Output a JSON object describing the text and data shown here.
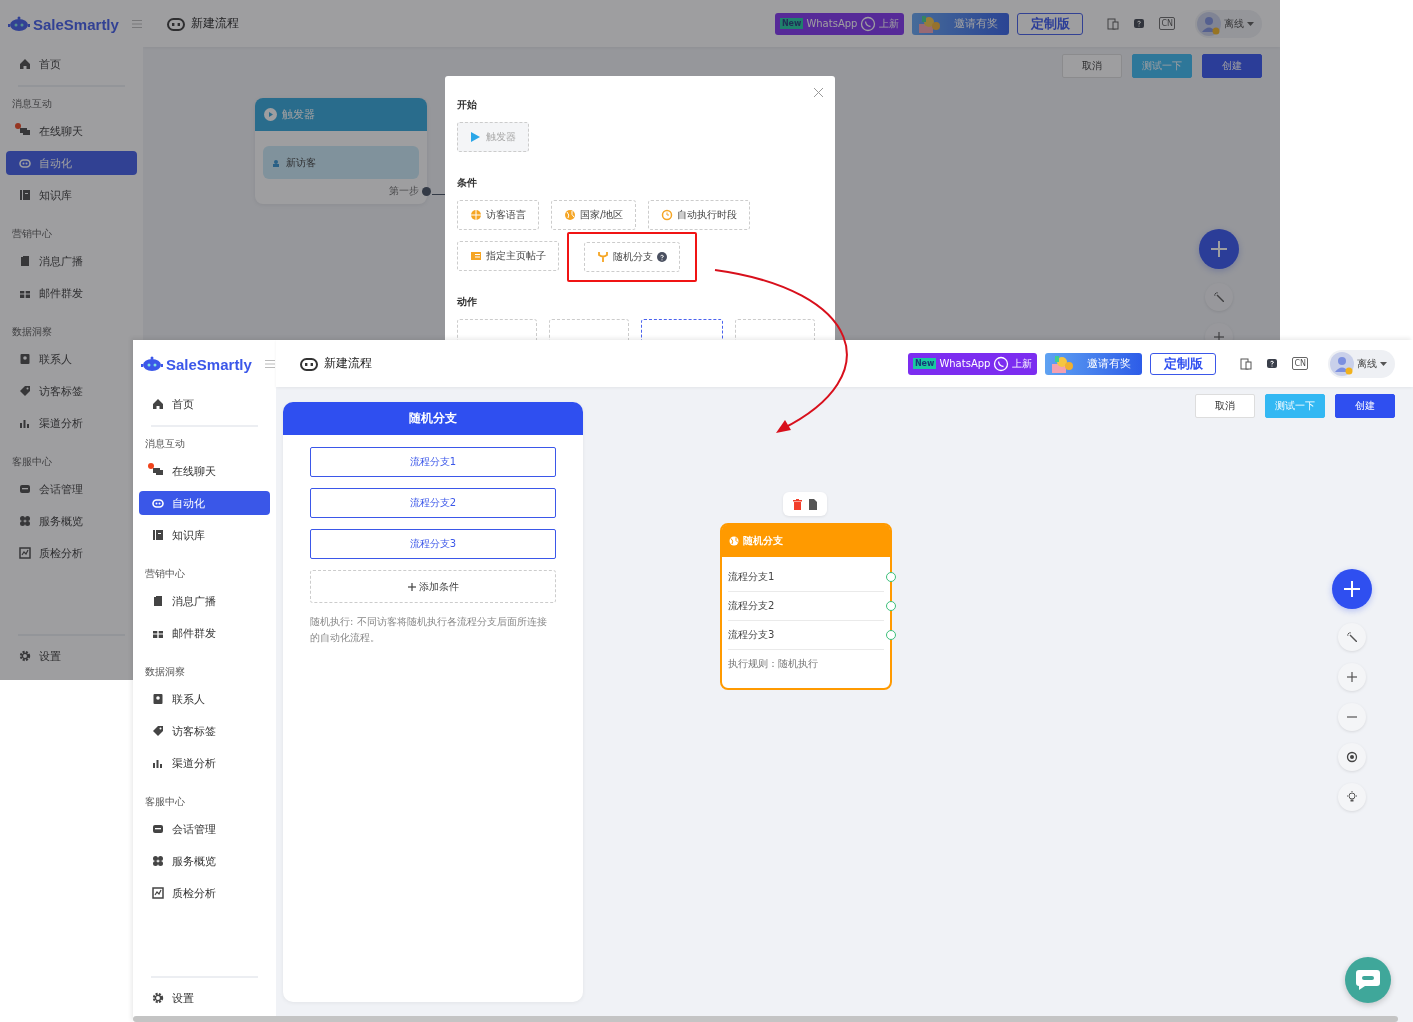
{
  "screens": [
    {
      "kind": "dialog-open",
      "dimmed": true,
      "sidebar": {
        "brand": "SaleSmartly",
        "sections": [
          {
            "items": [
              {
                "label": "首页",
                "selected": false,
                "badge": false
              }
            ]
          },
          {
            "title": "消息互动",
            "items": [
              {
                "label": "在线聊天",
                "selected": false,
                "badge": true
              },
              {
                "label": "自动化",
                "selected": true,
                "badge": false
              },
              {
                "label": "知识库",
                "selected": false,
                "badge": false
              }
            ]
          },
          {
            "title": "营销中心",
            "items": [
              {
                "label": "消息广播",
                "selected": false,
                "badge": false
              },
              {
                "label": "邮件群发",
                "selected": false,
                "badge": false
              }
            ]
          },
          {
            "title": "数据洞察",
            "items": [
              {
                "label": "联系人",
                "selected": false,
                "badge": false
              },
              {
                "label": "访客标签",
                "selected": false,
                "badge": false
              },
              {
                "label": "渠道分析",
                "selected": false,
                "badge": false
              }
            ]
          },
          {
            "title": "客服中心",
            "items": [
              {
                "label": "会话管理",
                "selected": false,
                "badge": false
              },
              {
                "label": "服务概览",
                "selected": false,
                "badge": false
              },
              {
                "label": "质检分析",
                "selected": false,
                "badge": false
              }
            ]
          }
        ],
        "footer_item": "设置"
      },
      "header": {
        "title": "新建流程",
        "whatsapp_badge": {
          "tag": "New",
          "name": "WhatsApp",
          "suffix": "上新"
        },
        "invite_banner": "邀请有奖",
        "plan_button": "定制版",
        "language_badge": "CN",
        "status": "离线"
      },
      "toolbar_buttons": [
        {
          "label": "取消",
          "kind": "default"
        },
        {
          "label": "测试一下",
          "kind": "test"
        },
        {
          "label": "创建",
          "kind": "primary"
        }
      ],
      "nodes": [
        {
          "kind": "trigger",
          "title": "触发器",
          "items": [
            "新访客"
          ],
          "footer": "第一步",
          "selected": false
        }
      ],
      "dialog": {
        "sections": [
          {
            "title": "开始",
            "options": [
              {
                "label": "触发器",
                "disabled": true,
                "highlighted": false,
                "help": false
              }
            ]
          },
          {
            "title": "条件",
            "options": [
              {
                "label": "访客语言",
                "disabled": false,
                "highlighted": false,
                "help": false
              },
              {
                "label": "国家/地区",
                "disabled": false,
                "highlighted": false,
                "help": false
              },
              {
                "label": "自动执行时段",
                "disabled": false,
                "highlighted": false,
                "help": false
              },
              {
                "label": "指定主页帖子",
                "disabled": false,
                "highlighted": false,
                "help": false
              },
              {
                "label": "随机分支",
                "disabled": false,
                "highlighted": true,
                "help": true
              }
            ]
          },
          {
            "title": "动作",
            "options": [
              {
                "active": false
              },
              {
                "active": false
              },
              {
                "active": true
              },
              {
                "active": false
              }
            ]
          }
        ]
      },
      "canvas_tools": [
        {
          "kind": "add"
        },
        {
          "kind": "magic"
        },
        {
          "kind": "zoom-in"
        }
      ],
      "chat_launcher": false
    },
    {
      "kind": "editor",
      "dimmed": false,
      "sidebar": {
        "brand": "SaleSmartly",
        "sections": [
          {
            "items": [
              {
                "label": "首页",
                "selected": false,
                "badge": false
              }
            ]
          },
          {
            "title": "消息互动",
            "items": [
              {
                "label": "在线聊天",
                "selected": false,
                "badge": true
              },
              {
                "label": "自动化",
                "selected": true,
                "badge": false
              },
              {
                "label": "知识库",
                "selected": false,
                "badge": false
              }
            ]
          },
          {
            "title": "营销中心",
            "items": [
              {
                "label": "消息广播",
                "selected": false,
                "badge": false
              },
              {
                "label": "邮件群发",
                "selected": false,
                "badge": false
              }
            ]
          },
          {
            "title": "数据洞察",
            "items": [
              {
                "label": "联系人",
                "selected": false,
                "badge": false
              },
              {
                "label": "访客标签",
                "selected": false,
                "badge": false
              },
              {
                "label": "渠道分析",
                "selected": false,
                "badge": false
              }
            ]
          },
          {
            "title": "客服中心",
            "items": [
              {
                "label": "会话管理",
                "selected": false,
                "badge": false
              },
              {
                "label": "服务概览",
                "selected": false,
                "badge": false
              },
              {
                "label": "质检分析",
                "selected": false,
                "badge": false
              }
            ]
          }
        ],
        "footer_item": "设置"
      },
      "header": {
        "title": "新建流程",
        "whatsapp_badge": {
          "tag": "New",
          "name": "WhatsApp",
          "suffix": "上新"
        },
        "invite_banner": "邀请有奖",
        "plan_button": "定制版",
        "language_badge": "CN",
        "status": "离线"
      },
      "toolbar_buttons": [
        {
          "label": "取消",
          "kind": "default"
        },
        {
          "label": "测试一下",
          "kind": "test"
        },
        {
          "label": "创建",
          "kind": "primary"
        }
      ],
      "branch_panel": {
        "title": "随机分支",
        "branches": [
          "流程分支1",
          "流程分支2",
          "流程分支3"
        ],
        "add_label": "添加条件",
        "note": "随机执行: 不同访客将随机执行各流程分支后面所连接的自动化流程。"
      },
      "nodes": [
        {
          "kind": "random-branch",
          "title": "随机分支",
          "items": [
            "流程分支1",
            "流程分支2",
            "流程分支3"
          ],
          "footer": "执行规则：随机执行",
          "selected": true
        }
      ],
      "canvas_tools": [
        {
          "kind": "add"
        },
        {
          "kind": "magic"
        },
        {
          "kind": "zoom-in"
        },
        {
          "kind": "zoom-out"
        },
        {
          "kind": "locate"
        },
        {
          "kind": "tips"
        }
      ],
      "chat_launcher": true
    }
  ],
  "annotation": {
    "kind": "curved-arrow"
  }
}
